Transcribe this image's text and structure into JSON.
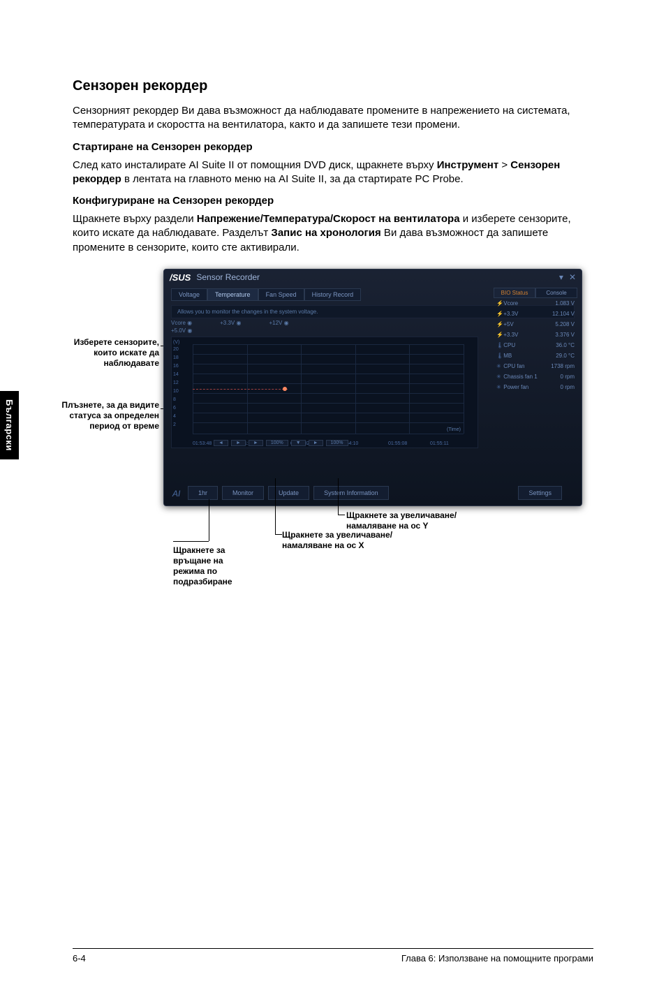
{
  "side_tab": "Български",
  "title": "Сензорен рекордер",
  "intro": "Сензорният рекордер Ви дава възможност да наблюдавате промените в напрежението на системата, температурата и скоростта на вентилатора, както и да запишете тези промени.",
  "section1_h": "Стартиране на Сензорен рекордер",
  "section1_p_a": "След като инсталирате AI Suite II от помощния DVD диск, щракнете върху ",
  "section1_p_b1": "Инструмент",
  "section1_p_gt": " > ",
  "section1_p_b2": "Сензорен рекордер",
  "section1_p_c": " в лентата на главното меню на AI Suite II, за да стартирате PC Probe.",
  "section2_h": "Конфигуриране на Сензорен рекордер",
  "section2_p_a": "Щракнете върху раздели ",
  "section2_p_b1": "Напрежение/Температура/Скорост на вентилатора",
  "section2_p_b": " и изберете сензорите, които искате да наблюдавате. Разделът ",
  "section2_p_b2": "Запис на хронология",
  "section2_p_c": " Ви дава възможност да запишете промените в сензорите, които сте активирали.",
  "app": {
    "brand": "/SUS",
    "title": "Sensor Recorder",
    "tabs": [
      "Voltage",
      "Temperature",
      "Fan Speed",
      "History Record"
    ],
    "active_tab": 1,
    "desc": "Allows you to monitor the changes in the system voltage.",
    "checks": [
      "Vcore ◉",
      "+3.3V ◉",
      "+12V ◉"
    ],
    "check2": "+5.0V ◉",
    "right_tabs": [
      "BIO Status",
      "Console"
    ],
    "sensors": [
      {
        "icon": "⚡",
        "name": "Vcore",
        "val": "1.083 V"
      },
      {
        "icon": "⚡",
        "name": "+3.3V",
        "val": "12.104 V"
      },
      {
        "icon": "⚡",
        "name": "+5V",
        "val": "5.208 V"
      },
      {
        "icon": "⚡",
        "name": "+3.3V",
        "val": "3.376 V"
      },
      {
        "icon": "🌡",
        "name": "CPU",
        "val": "36.0 °C"
      },
      {
        "icon": "🌡",
        "name": "MB",
        "val": "29.0 °C"
      },
      {
        "icon": "✳",
        "name": "CPU fan",
        "val": "1738 rpm"
      },
      {
        "icon": "✳",
        "name": "Chassis fan 1",
        "val": "0 rpm"
      },
      {
        "icon": "✳",
        "name": "Power fan",
        "val": "0 rpm"
      }
    ],
    "ylabels": [
      "(V)",
      "20",
      "18",
      "16",
      "14",
      "12",
      "10",
      "8",
      "6",
      "4",
      "2"
    ],
    "xlabels": [
      "01:53:48",
      "01:53:56",
      "01:54:02",
      "01:54:10",
      "01:55:08",
      "01:55:11"
    ],
    "time_lbl": "(Time)",
    "zoom": [
      "◄",
      "►",
      "►",
      "100%",
      "▼",
      "►",
      "100%"
    ],
    "buttons": [
      "1hr",
      "Monitor",
      "Update",
      "System Information"
    ],
    "settings": "Settings"
  },
  "callouts": {
    "c1": "Изберете сензорите, които искате да наблюдавате",
    "c2": "Плъзнете, за да видите статуса за определен период от време",
    "c3": "Щракнете за връщане на режима по подразбиране",
    "c4": "Щракнете за увеличаване/ намаляване на ос X",
    "c5": "Щракнете за увеличаване/ намаляване на ос Y"
  },
  "footer": {
    "left": "6-4",
    "right": "Глава 6: Използване на помощните програми"
  },
  "chart_data": {
    "type": "line",
    "title": "",
    "xlabel": "(Time)",
    "ylabel": "(V)",
    "ylim": [
      2,
      20
    ],
    "x": [
      "01:53:48",
      "01:53:56",
      "01:54:02",
      "01:54:10",
      "01:55:08",
      "01:55:11"
    ],
    "series": [
      {
        "name": "Vcore",
        "values": [
          10,
          10,
          10,
          null,
          null,
          null
        ]
      }
    ]
  }
}
